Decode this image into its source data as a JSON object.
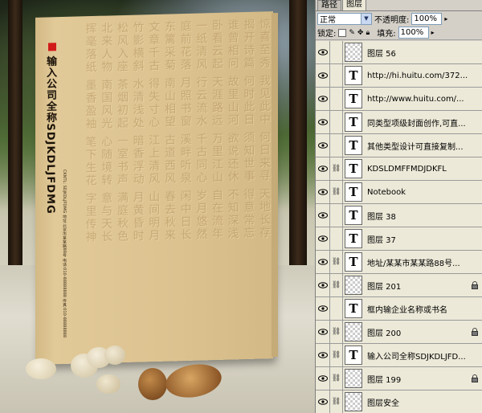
{
  "panel": {
    "tabs": [
      "路径",
      "图层"
    ],
    "active_tab": "图层",
    "blend_mode": "正常",
    "opacity_label": "不透明度:",
    "opacity_value": "100%",
    "lock_label": "锁定:",
    "fill_label": "填充:",
    "fill_value": "100%"
  },
  "layers": [
    {
      "name": "图层 56",
      "type": "raster",
      "linked": false,
      "locked": false
    },
    {
      "name": "http://hi.huitu.com/372...",
      "type": "text",
      "linked": false,
      "locked": false
    },
    {
      "name": "http://www.huitu.com/...",
      "type": "text",
      "linked": false,
      "locked": false
    },
    {
      "name": "同类型项级封面创作,可直...",
      "type": "text",
      "linked": false,
      "locked": false
    },
    {
      "name": "其他类型设计可直接复制...",
      "type": "text",
      "linked": false,
      "locked": false
    },
    {
      "name": "KDSLDMFFMDJDKFL",
      "type": "text",
      "linked": true,
      "locked": false
    },
    {
      "name": "Notebook",
      "type": "text",
      "linked": true,
      "locked": false
    },
    {
      "name": "图层 38",
      "type": "text",
      "linked": false,
      "locked": false
    },
    {
      "name": "图层 37",
      "type": "text",
      "linked": false,
      "locked": false
    },
    {
      "name": "地址/某某市某某路88号...",
      "type": "text",
      "linked": true,
      "locked": false
    },
    {
      "name": "图层 201",
      "type": "raster",
      "linked": true,
      "locked": true
    },
    {
      "name": "框内输企业名称或书名",
      "type": "text",
      "linked": false,
      "locked": false
    },
    {
      "name": "图层 200",
      "type": "raster",
      "linked": true,
      "locked": true
    },
    {
      "name": "输入公司全称SDJKDLJFD...",
      "type": "text",
      "linked": true,
      "locked": false
    },
    {
      "name": "图层 199",
      "type": "raster",
      "linked": true,
      "locked": true
    },
    {
      "name": "图层安全",
      "type": "raster",
      "linked": true,
      "locked": false
    }
  ],
  "book": {
    "title": "输入公司全称SDJKDLJFDMG",
    "subtitle": "CKNTL: SDJKDLJFDMG 地址:北京市某某路88号 电话:010-88888888 传真:010-88888888",
    "calligraphy": [
      "惊喜至秀 我见此中 何日来寻 天地长存",
      "揭开诗篇 何时此日 须知世事 得意常忘",
      "谁曾相问 故里山河 欲说还休 不知深浅",
      "卧看云起 天涯路远 万里江山 自在流年",
      "一纸清风 行云流水 千古同心 岁月悠然",
      "庭前花落 月照书窗 溪畔听泉 闲中日长",
      "东篱采菊 南山相望 古道西风 春去秋来",
      "文章千古 得失寸心 江上清风 山间明月",
      "竹影横斜 水清浅处 暗香浮动 月黄昏时",
      "松风入座 茶烟初起 一室书声 满庭秋色",
      "北来人物 南国风光 心随境转 意与天长",
      "挥毫落纸 墨香盈袖 笔下生花 字里传神"
    ]
  },
  "colors": {
    "panel_bg": "#d4d0c8",
    "layer_bg": "#ece9d8",
    "book_cover": "#dcc28f",
    "red_mark": "#d11a1a"
  }
}
